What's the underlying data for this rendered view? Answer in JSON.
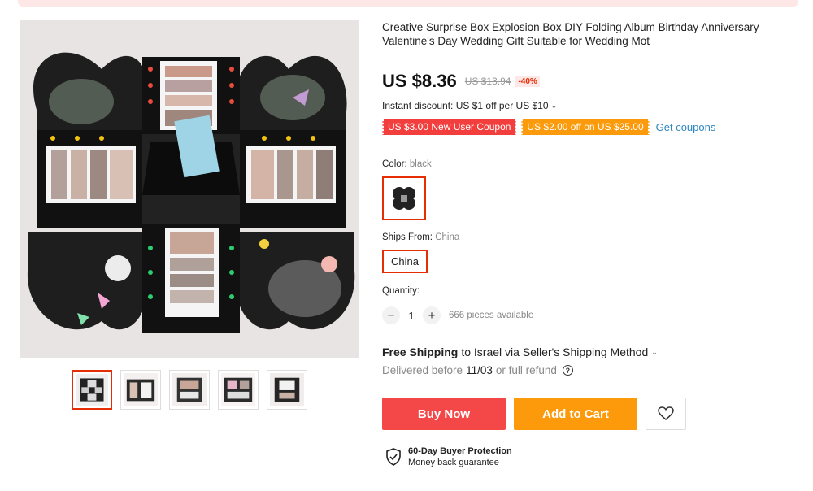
{
  "product": {
    "title": "Creative Surprise Box Explosion Box DIY Folding Album Birthday Anniversary Valentine's Day Wedding Gift Suitable for Wedding Mot",
    "price": "US $8.36",
    "original_price": "US $13.94",
    "discount": "-40%"
  },
  "promotions": {
    "instant_discount": "Instant discount: US $1 off per US $10",
    "coupons": [
      "US $3.00 New User Coupon",
      "US $2.00 off on US $25.00"
    ],
    "get_coupons_label": "Get coupons",
    "colors": {
      "red_coupon": "#f33e3e",
      "orange_coupon": "#fb9a0a"
    }
  },
  "options": {
    "color_label": "Color:",
    "color_value": "black",
    "ships_from_label": "Ships From:",
    "ships_from_value": "China",
    "ships_from_option": "China"
  },
  "quantity": {
    "label": "Quantity:",
    "minus": "−",
    "value": "1",
    "plus": "+",
    "available": "666 pieces available"
  },
  "shipping": {
    "free_label": "Free Shipping",
    "destination": "to Israel via Seller's Shipping Method",
    "delivery_prefix": "Delivered before",
    "delivery_date": "11/03",
    "delivery_suffix": "or full refund",
    "help_glyph": "?"
  },
  "actions": {
    "buy_now": "Buy Now",
    "add_to_cart": "Add to Cart",
    "buy_color": "#f44848",
    "cart_color": "#fd9a0b"
  },
  "protection": {
    "title": "60-Day Buyer Protection",
    "subtitle": "Money back guarantee"
  },
  "gallery": {
    "thumbnail_count": 5,
    "active_index": 0,
    "accent": "#e62e04"
  }
}
